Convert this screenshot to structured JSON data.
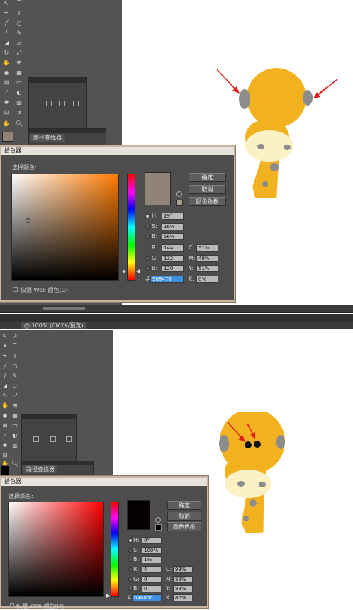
{
  "top": {
    "panel_tab": "路径查找器",
    "dialog": {
      "title": "拾色器",
      "select_color_label": "选择颜色:",
      "ok_label": "确定",
      "cancel_label": "取消",
      "swatches_label": "颜色色板",
      "web_only_label": "仅限 Web 颜色(O)",
      "hash": "#",
      "hex": "908478",
      "fields": {
        "h": {
          "label": "H:",
          "value": "29°"
        },
        "s": {
          "label": "S:",
          "value": "16%"
        },
        "b": {
          "label": "B:",
          "value": "56%"
        },
        "r": {
          "label": "R:",
          "value": "144"
        },
        "g": {
          "label": "G:",
          "value": "132"
        },
        "bb": {
          "label": "B:",
          "value": "120"
        },
        "c": {
          "label": "C:",
          "value": "51%"
        },
        "m": {
          "label": "M:",
          "value": "48%"
        },
        "y": {
          "label": "Y:",
          "value": "51%"
        },
        "k": {
          "label": "K:",
          "value": "0%"
        }
      },
      "preview_color": "#908478",
      "hue_color": "#ff7a00"
    }
  },
  "bottom": {
    "doc_tab": "@ 100% (CMYK/预览)",
    "panel_tab": "路径查找器",
    "dialog": {
      "title": "拾色器",
      "select_color_label": "选择颜色:",
      "ok_label": "确定",
      "cancel_label": "取消",
      "swatches_label": "颜色色板",
      "web_only_label": "仅限 Web 颜色(O)",
      "hash": "#",
      "hex": "040000",
      "fields": {
        "h": {
          "label": "H:",
          "value": "0°"
        },
        "s": {
          "label": "S:",
          "value": "100%"
        },
        "b": {
          "label": "B:",
          "value": "1%"
        },
        "r": {
          "label": "R:",
          "value": "4"
        },
        "g": {
          "label": "G:",
          "value": "0"
        },
        "bb": {
          "label": "B:",
          "value": "0"
        },
        "c": {
          "label": "C:",
          "value": "93%"
        },
        "m": {
          "label": "M:",
          "value": "88%"
        },
        "y": {
          "label": "Y:",
          "value": "89%"
        },
        "k": {
          "label": "K:",
          "value": "80%"
        }
      },
      "preview_color": "#040000",
      "hue_color": "#ff0000"
    }
  },
  "colors": {
    "giraffe_body": "#f2b11f",
    "giraffe_face": "#fbf1c5",
    "giraffe_spot": "#8c8c8c",
    "arrow": "#e31b1b",
    "eye": "#111111"
  }
}
